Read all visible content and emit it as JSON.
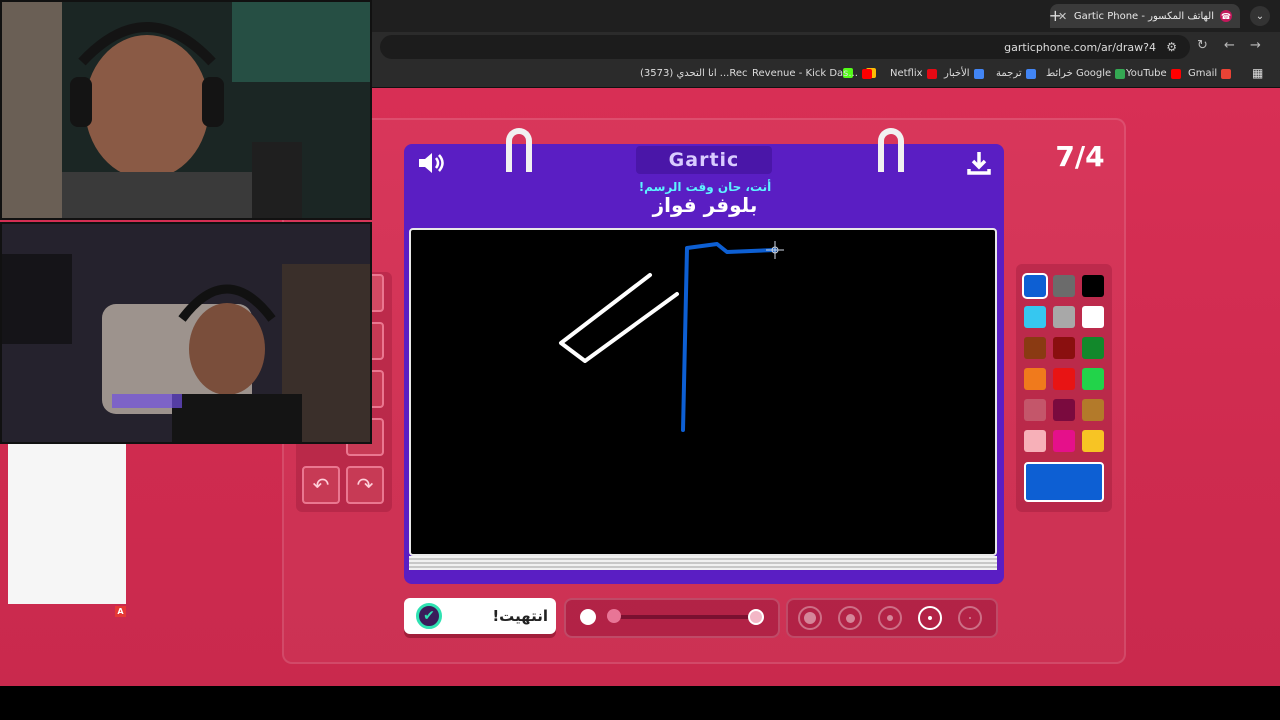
{
  "browser": {
    "tab_title": "Gartic Phone - الهاتف المكسور",
    "tab_favicon": "☎",
    "url": "garticphone.com/ar/draw?4",
    "bookmarks": [
      {
        "label": "Gmail",
        "color": "#ea4335"
      },
      {
        "label": "YouTube",
        "color": "#ff0000"
      },
      {
        "label": "خرائط Google",
        "color": "#34a853"
      },
      {
        "label": "ترجمة",
        "color": "#4285f4"
      },
      {
        "label": "الأخبار",
        "color": "#4285f4"
      },
      {
        "label": "Netflix",
        "color": "#e50914"
      },
      {
        "label": "",
        "color": "#fbbc05"
      },
      {
        "label": "",
        "color": "#53fc18"
      },
      {
        "label": "Revenue - Kick Das...",
        "color": "#ff0000"
      },
      {
        "label": "(3573) انا التحدي ...Rec",
        "color": ""
      }
    ]
  },
  "game": {
    "logo": "Gartic",
    "subtitle": "أنت، حان وقت الرسم!",
    "word": "بلوفر فواز",
    "round": "7/4",
    "done_label": "انتهيت!",
    "colors": {
      "palette": [
        "#0d5fd3",
        "#6b6b6b",
        "#000000",
        "#36c7f0",
        "#a8a8a8",
        "#ffffff",
        "#8a3a12",
        "#8a0f0f",
        "#12882b",
        "#f07a1c",
        "#e81414",
        "#22d34a",
        "#c4566a",
        "#7a0a3e",
        "#b37a2a",
        "#f7b0b8",
        "#e5108a",
        "#f7c424"
      ],
      "selected": "#0d5fd3"
    },
    "opacity_level": 0.0,
    "selected_brush_size_index": 3
  },
  "overlay": {
    "badge": "A"
  }
}
